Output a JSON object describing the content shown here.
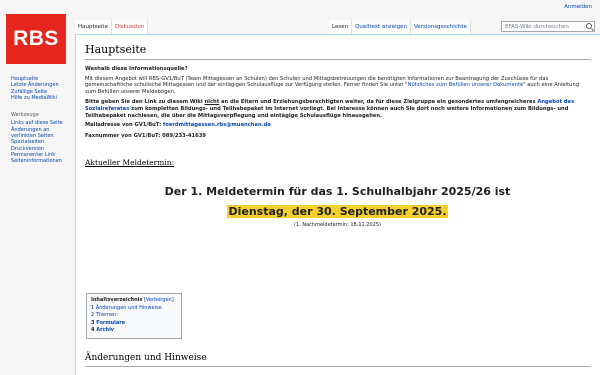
{
  "logo": "RBS",
  "personal": {
    "login": "Anmelden"
  },
  "tabs": {
    "main": "Hauptseite",
    "discussion": "Diskussion",
    "read": "Lesen",
    "source": "Quelltext anzeigen",
    "history": "Versionsgeschichte"
  },
  "search": {
    "placeholder": "EFAS-Wiki durchsuchen"
  },
  "sidebar": {
    "nav": [
      "Hauptseite",
      "Letzte Änderungen",
      "Zufällige Seite",
      "Hilfe zu MediaWiki"
    ],
    "tools_heading": "Werkzeuge",
    "tools": [
      "Links auf diese Seite",
      "Änderungen an verlinkten Seiten",
      "Spezialseiten",
      "Druckversion",
      "Permanenter Link",
      "Seiteninformationen"
    ]
  },
  "page": {
    "title": "Hauptseite",
    "intro_heading": "Weshalb diese Informationsquelle?",
    "intro_1": "Mit diesem Angebot will RBS-GV1/BuT (Team Mittagessen an Schulen) den Schulen und Mittagsbetreuungen die benötigten Informationen zur Beantragung der Zuschüsse für das gemeinschaftliche schulische Mittagessen und der eintägigen Schulausflüge zur Verfügung stellen. Ferner finden Sie unter \"",
    "intro_link": "Nützliches zum Befüllen unserer Dokumente",
    "intro_2": "\" auch eine Anleitung zum Befüllen unserer Meldebögen.",
    "note_1": "Bitte geben Sie den Link zu diesem Wiki ",
    "note_not": "nicht",
    "note_2": " an die Eltern und Erziehungsberechtigten weiter, da für diese Zielgruppe ein gesondertes umfangreicheres ",
    "note_link": "Angebot des Sozialreferates",
    "note_3": " zum kompletten Bildungs- und Teilhabepaket im Internet vorliegt. Bei Interesse können auch Sie dort noch weitere Informationen zum Bildungs- und Teilhabepaket nachlesen, die über die Mittagsverpflegung und eintägige Schulausflüge hinausgehen.",
    "mail_label": "Mailadresse von GV1/BuT: ",
    "mail": "foerdmittagessen.rbs@muenchen.de",
    "fax": "Faxnummer von GV1/BuT: 089/233-41639",
    "current_heading": "Aktueller Meldetermin:",
    "deadline_line": "Der 1. Meldetermin für das 1. Schulhalbjahr 2025/26 ist",
    "deadline_date": "Dienstag, der 30. September 2025.",
    "next_deadline": "(1. Nachmeldetermin: 18.11.2025)",
    "section_h2": "Änderungen und Hinweise"
  },
  "toc": {
    "title": "Inhaltsverzeichnis",
    "toggle": "[Verbergen]",
    "items": [
      {
        "num": "1",
        "label": "Änderungen und Hinweise"
      },
      {
        "num": "2",
        "label": "Themen"
      },
      {
        "num": "3",
        "label": "Formulare"
      },
      {
        "num": "4",
        "label": "Archiv"
      }
    ]
  },
  "colors": {
    "logo_bg": "#e4261c",
    "link": "#0645ad",
    "highlight": "#f3d02b",
    "discussion_tab": "#d33"
  }
}
